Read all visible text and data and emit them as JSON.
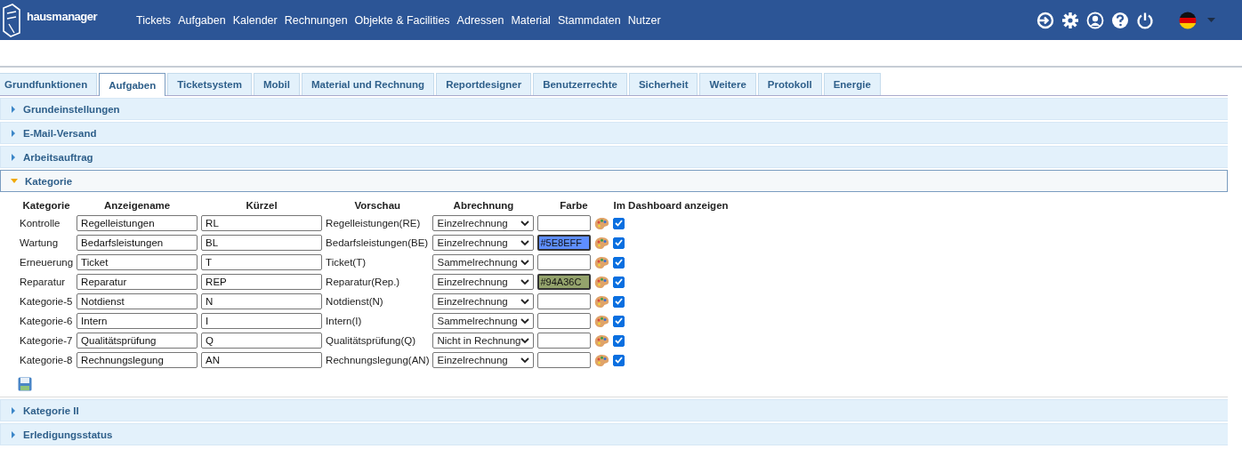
{
  "header": {
    "logo": "hausmanager",
    "nav": [
      "Tickets",
      "Aufgaben",
      "Kalender",
      "Rechnungen",
      "Objekte & Facilities",
      "Adressen",
      "Material",
      "Stammdaten",
      "Nutzer"
    ]
  },
  "tabs": [
    {
      "label": "Grundfunktionen",
      "selected": false
    },
    {
      "label": "Aufgaben",
      "selected": true
    },
    {
      "label": "Ticketsystem",
      "selected": false
    },
    {
      "label": "Mobil",
      "selected": false
    },
    {
      "label": "Material und Rechnung",
      "selected": false
    },
    {
      "label": "Reportdesigner",
      "selected": false
    },
    {
      "label": "Benutzerrechte",
      "selected": false
    },
    {
      "label": "Sicherheit",
      "selected": false
    },
    {
      "label": "Weitere",
      "selected": false
    },
    {
      "label": "Protokoll",
      "selected": false
    },
    {
      "label": "Energie",
      "selected": false
    }
  ],
  "sections_before": [
    {
      "title": "Grundeinstellungen",
      "expanded": false
    },
    {
      "title": "E-Mail-Versand",
      "expanded": false
    },
    {
      "title": "Arbeitsauftrag",
      "expanded": false
    }
  ],
  "open_section": {
    "title": "Kategorie",
    "expanded": true,
    "columns": [
      "Kategorie",
      "Anzeigename",
      "Kürzel",
      "Vorschau",
      "Abrechnung",
      "Farbe",
      "Im Dashboard anzeigen"
    ],
    "rows": [
      {
        "kategorie": "Kontrolle",
        "anzeigename": "Regelleistungen",
        "kuerzel": "RL",
        "vorschau": "Regelleistungen(RE)",
        "abrechnung": "Einzelrechnung",
        "dashboard": true
      },
      {
        "kategorie": "Wartung",
        "anzeigename": "Bedarfsleistungen",
        "kuerzel": "BL",
        "vorschau": "Bedarfsleistungen(BE)",
        "abrechnung": "Einzelrechnung",
        "farbe": "#5E8EFF",
        "dashboard": true
      },
      {
        "kategorie": "Erneuerung",
        "anzeigename": "Ticket",
        "kuerzel": "T",
        "vorschau": "Ticket(T)",
        "abrechnung": "Sammelrechnung",
        "dashboard": true
      },
      {
        "kategorie": "Reparatur",
        "anzeigename": "Reparatur",
        "kuerzel": "REP",
        "vorschau": "Reparatur(Rep.)",
        "abrechnung": "Einzelrechnung",
        "farbe": "#94A36C",
        "dashboard": true
      },
      {
        "kategorie": "Kategorie-5",
        "anzeigename": "Notdienst",
        "kuerzel": "N",
        "vorschau": "Notdienst(N)",
        "abrechnung": "Einzelrechnung",
        "dashboard": true
      },
      {
        "kategorie": "Kategorie-6",
        "anzeigename": "Intern",
        "kuerzel": "I",
        "vorschau": "Intern(I)",
        "abrechnung": "Sammelrechnung",
        "dashboard": true
      },
      {
        "kategorie": "Kategorie-7",
        "anzeigename": "Qualitätsprüfung",
        "kuerzel": "Q",
        "vorschau": "Qualitätsprüfung(Q)",
        "abrechnung": "Nicht in Rechnung",
        "dashboard": true
      },
      {
        "kategorie": "Kategorie-8",
        "anzeigename": "Rechnungslegung",
        "kuerzel": "AN",
        "vorschau": "Rechnungslegung(AN)",
        "abrechnung": "Einzelrechnung",
        "dashboard": true
      }
    ]
  },
  "sections_after": [
    {
      "title": "Kategorie II",
      "expanded": false
    },
    {
      "title": "Erledigungsstatus",
      "expanded": false
    }
  ]
}
